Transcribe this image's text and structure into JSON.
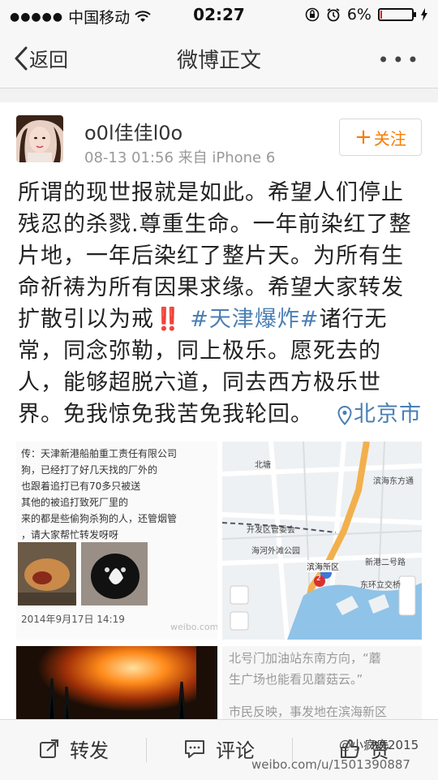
{
  "status_bar": {
    "carrier": "中国移动",
    "time": "02:27",
    "battery_percent": "6%",
    "battery_level": 0.06,
    "colors": {
      "battery_low": "#e02020"
    }
  },
  "nav": {
    "back_label": "返回",
    "title": "微博正文",
    "more_label": "•••"
  },
  "post": {
    "username": "o0l佳佳l0o",
    "time": "08-13 01:56",
    "source": "来自 iPhone 6",
    "follow_label": "关注",
    "text_part1": "所谓的现世报就是如此。希望人们停止残忍的杀戮.尊重生命。一年前染红了整片地，一年后染红了整片天。为所有生命祈祷为所有因果求缘。希望大家转发扩散引以为戒",
    "alert_glyph": "‼️",
    "topic": "#天津爆炸#",
    "text_part2": "诸行无常，同念弥勒，同上极乐。愿死去的人，能够超脱六道，同去西方极乐世界。免我惊免我苦免我轮回。",
    "location": "北京市",
    "colors": {
      "link": "#4a7fb5",
      "follow": "#f57c00"
    }
  },
  "images": {
    "screenshot": {
      "lines": [
        "传：天津新港船舶重工责任有限公司",
        "狗，已经打了好几天找的厂外的",
        "也跟着追打已有70多只被送",
        "其他的被追打致死厂里的",
        "来的都是些偷狗杀狗的人，还管烟管",
        "，请大家帮忙转发呀呀"
      ],
      "date": "2014年9月17日 14:19",
      "watermark": "weibo.com"
    },
    "map": {
      "labels": [
        "开发区管委会",
        "滨海新区",
        "东环立交桥",
        "新港二号路",
        "海河外滩公园",
        "滨海东方通",
        "北塘"
      ],
      "markers": [
        "1",
        "2"
      ]
    },
    "news": {
      "lines": [
        "北号门加油站东南方向，“蘑",
        "生广场也能看见蘑菇云。”",
        "市民反映，事发地在滨海新区"
      ]
    }
  },
  "bottom_bar": {
    "repost_label": "转发",
    "comment_label": "评论",
    "like_label": "赞",
    "watermark_user": "@小疯疯2015",
    "watermark_url": "weibo.com/u/1501390887"
  }
}
